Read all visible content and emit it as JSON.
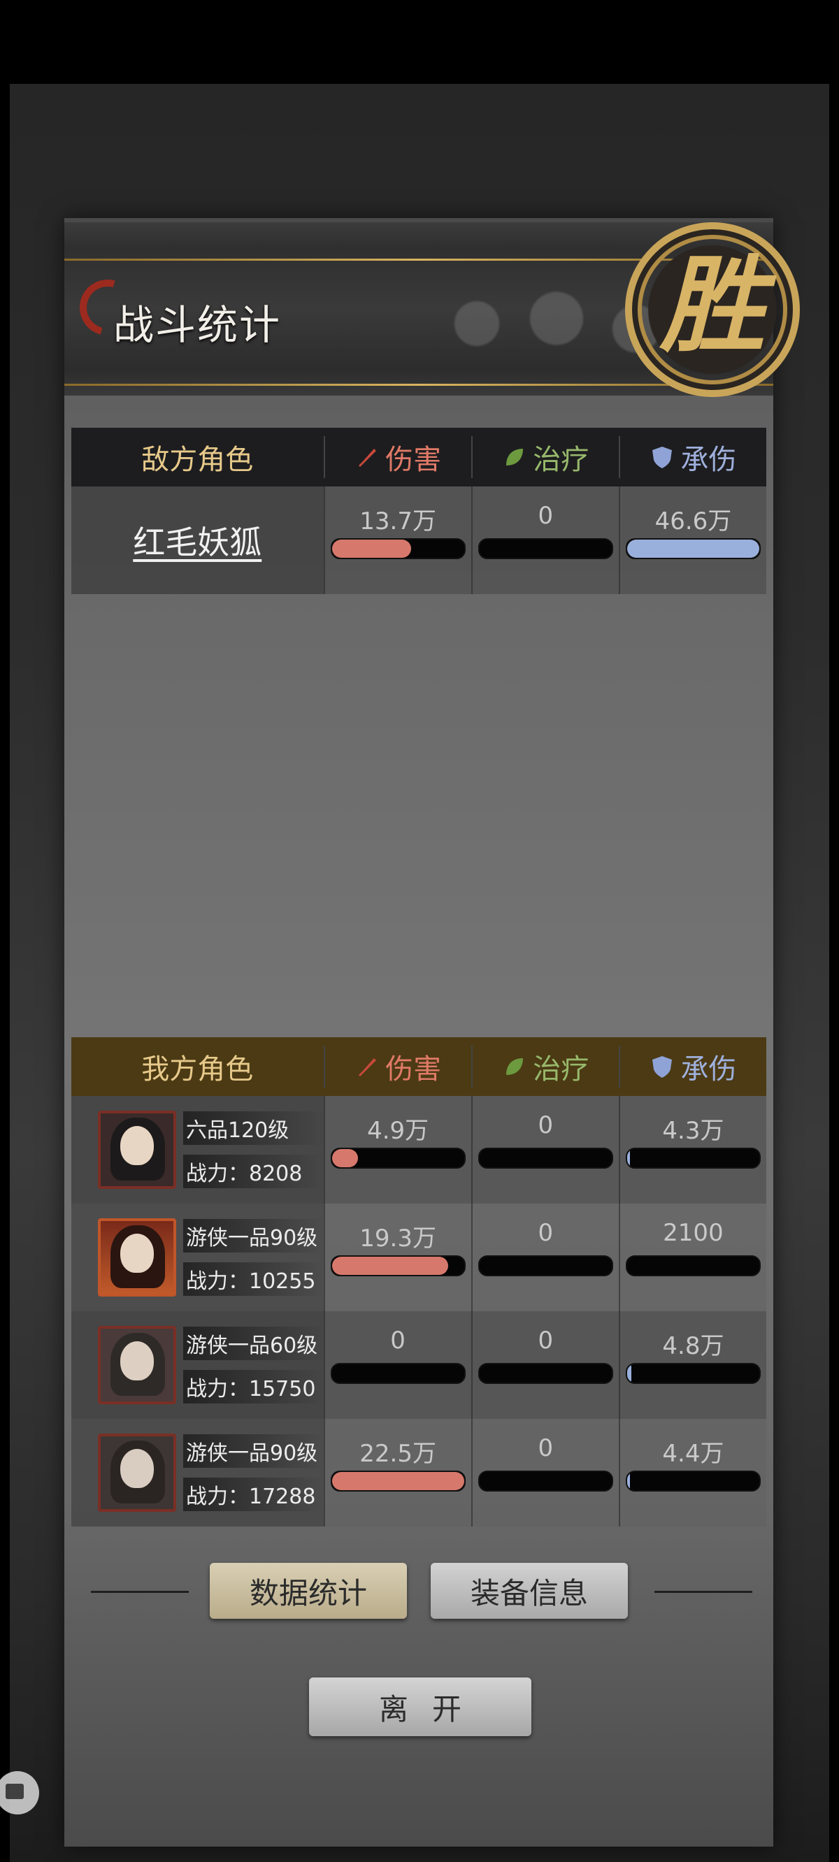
{
  "header": {
    "title": "战斗统计",
    "seal_char": "胜"
  },
  "enemy_table": {
    "title": "敌方角色",
    "columns": {
      "damage": "伤害",
      "healing": "治疗",
      "tanked": "承伤"
    },
    "rows": [
      {
        "name": "红毛妖狐",
        "damage": "13.7万",
        "damage_fill": 0.6,
        "healing": "0",
        "healing_fill": 0,
        "tanked": "46.6万",
        "tanked_fill": 1.0
      }
    ]
  },
  "ally_table": {
    "title": "我方角色",
    "columns": {
      "damage": "伤害",
      "healing": "治疗",
      "tanked": "承伤"
    },
    "rows": [
      {
        "rank": "六品120级",
        "power": "战力：8208",
        "damage": "4.9万",
        "damage_fill": 0.2,
        "healing": "0",
        "healing_fill": 0,
        "tanked": "4.3万",
        "tanked_fill": 0.02
      },
      {
        "rank": "游侠一品90级",
        "power": "战力：10255",
        "damage": "19.3万",
        "damage_fill": 0.88,
        "healing": "0",
        "healing_fill": 0,
        "tanked": "2100",
        "tanked_fill": 0
      },
      {
        "rank": "游侠一品60级",
        "power": "战力：15750",
        "damage": "0",
        "damage_fill": 0,
        "healing": "0",
        "healing_fill": 0,
        "tanked": "4.8万",
        "tanked_fill": 0.03
      },
      {
        "rank": "游侠一品90级",
        "power": "战力：17288",
        "damage": "22.5万",
        "damage_fill": 1.0,
        "healing": "0",
        "healing_fill": 0,
        "tanked": "4.4万",
        "tanked_fill": 0.02
      }
    ]
  },
  "buttons": {
    "stats": "数据统计",
    "equipment": "装备信息",
    "leave": "离开"
  },
  "icons": {
    "damage": "sword-icon",
    "healing": "leaf-icon",
    "tanked": "shield-icon"
  },
  "colors": {
    "damage": "#d6796c",
    "healing": "#8fb46a",
    "tanked": "#9ab0dc",
    "gold": "#d8b466"
  }
}
